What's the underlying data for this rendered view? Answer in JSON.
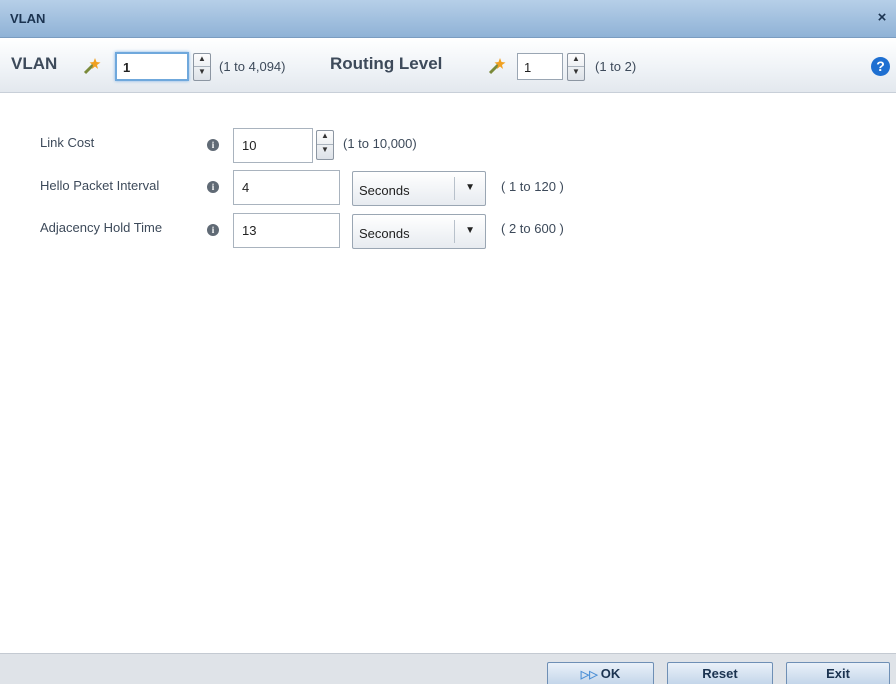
{
  "dialog": {
    "title": "VLAN",
    "close_label": "×"
  },
  "toolbar": {
    "vlan_label": "VLAN",
    "vlan_value": "1",
    "vlan_range": "(1 to 4,094)",
    "routing_level_label": "Routing Level",
    "routing_level_value": "1",
    "routing_level_range": "(1 to 2)",
    "help_label": "?"
  },
  "form": {
    "link_cost": {
      "label": "Link Cost",
      "value": "10",
      "range": "(1 to 10,000)"
    },
    "hello_packet_interval": {
      "label": "Hello Packet Interval",
      "value": "4",
      "unit": "Seconds",
      "range": "( 1 to 120 )"
    },
    "adjacency_hold_time": {
      "label": "Adjacency Hold Time",
      "value": "13",
      "unit": "Seconds",
      "range": "( 2 to 600 )"
    },
    "info_glyph": "i"
  },
  "footer": {
    "ok_label": "OK",
    "reset_label": "Reset",
    "exit_label": "Exit"
  },
  "icons": {
    "spin_up": "▲",
    "spin_down": "▼",
    "dropdown": "▼",
    "ok_glyph": "▷▷"
  },
  "colors": {
    "titlebar": "#a3c1e0",
    "accent": "#1e6fd1",
    "footer": "#dfe3e8"
  }
}
